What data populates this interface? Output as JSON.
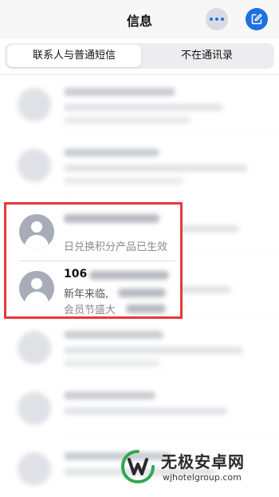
{
  "header": {
    "title": "信息",
    "accent": "#1e6fe0"
  },
  "segments": [
    {
      "label": "联系人与普通短信",
      "selected": true
    },
    {
      "label": "不在通讯录",
      "selected": false
    }
  ],
  "highlighted_conversations": [
    {
      "name": "",
      "preview_lines": [
        "日兑换积分产品已生效"
      ]
    },
    {
      "name": "106",
      "preview_lines": [
        "新年来临,",
        "会员节盛大"
      ]
    }
  ],
  "highlight_color": "#e53a3a",
  "watermark": {
    "title": "无极安卓网",
    "url": "wjhotelgroup.com"
  },
  "icons": [
    "more-icon",
    "compose-icon",
    "contact-avatar-icon"
  ]
}
